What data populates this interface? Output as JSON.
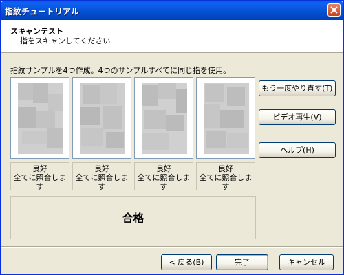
{
  "window": {
    "title": "指紋チュートリアル"
  },
  "header": {
    "title": "スキャンテスト",
    "subtitle": "指をスキャンしてください"
  },
  "instruction": "指紋サンプルを4つ作成。4つのサンプルすべてに同じ指を使用。",
  "samples": [
    {
      "quality": "良好",
      "match": "全てに照合します"
    },
    {
      "quality": "良好",
      "match": "全てに照合します"
    },
    {
      "quality": "良好",
      "match": "全てに照合します"
    },
    {
      "quality": "良好",
      "match": "全てに照合します"
    }
  ],
  "result": "合格",
  "side_buttons": {
    "retry": "もう一度やり直す(T)",
    "video": "ビデオ再生(V)",
    "help": "ヘルプ(H)"
  },
  "footer_buttons": {
    "back": "< 戻る(B)",
    "finish": "完了",
    "cancel": "キャンセル"
  }
}
